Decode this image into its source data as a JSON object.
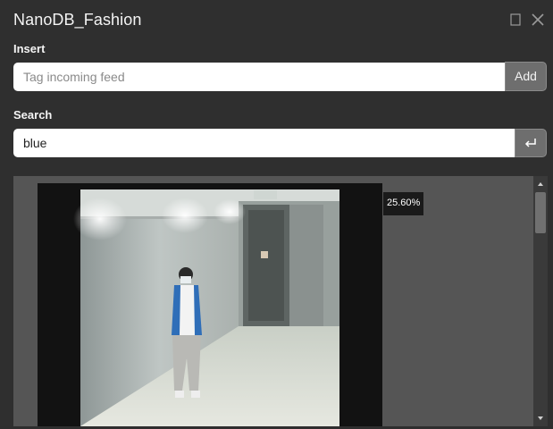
{
  "window": {
    "title": "NanoDB_Fashion"
  },
  "insert": {
    "label": "Insert",
    "placeholder": "Tag incoming feed",
    "value": "",
    "button_label": "Add"
  },
  "search": {
    "label": "Search",
    "value": "blue",
    "submit_icon": "enter-return-icon"
  },
  "results": {
    "items": [
      {
        "score": "25.60%",
        "thumbnail": "person-in-blue-jacket-walking-in-hallway"
      }
    ]
  },
  "colors": {
    "background": "#2f2f2f",
    "results_background": "#555555",
    "button": "#6e6e6e"
  }
}
